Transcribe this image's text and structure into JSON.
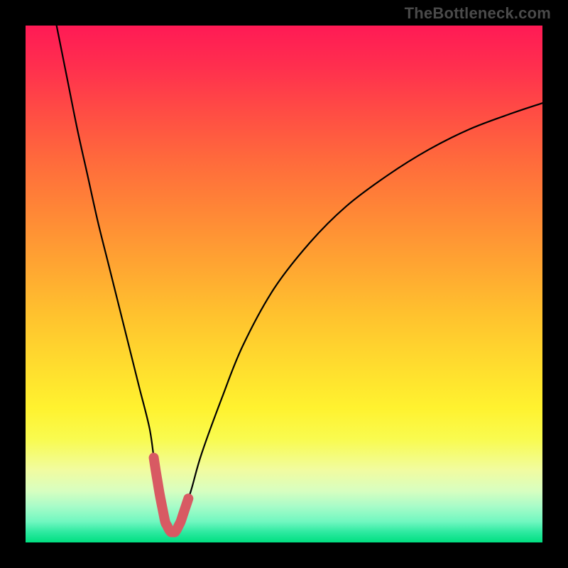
{
  "watermark": {
    "text": "TheBottleneck.com"
  },
  "chart_data": {
    "type": "line",
    "title": "",
    "xlabel": "",
    "ylabel": "",
    "xlim": [
      0,
      100
    ],
    "ylim": [
      0,
      100
    ],
    "grid": false,
    "series": [
      {
        "name": "curve",
        "x": [
          6,
          8,
          10,
          12,
          14,
          16,
          18,
          20,
          22,
          24,
          25,
          26,
          27,
          28,
          29,
          30,
          32,
          34,
          38,
          42,
          48,
          55,
          62,
          70,
          78,
          86,
          94,
          100
        ],
        "values": [
          100,
          90,
          80,
          71,
          62,
          54,
          46,
          38,
          30,
          22,
          15,
          9,
          4,
          2,
          2,
          4,
          10,
          17,
          28,
          38,
          49,
          58,
          65,
          71,
          76,
          80,
          83,
          85
        ]
      }
    ],
    "annotations": {
      "valley_marker": {
        "x_start": 24.8,
        "x_end": 31.5,
        "style": "thick-rounded",
        "color": "#d85a63"
      },
      "background_gradient": {
        "top": "#ff1a55",
        "mid": "#ffdd2e",
        "bottom": "#00df81"
      }
    }
  }
}
